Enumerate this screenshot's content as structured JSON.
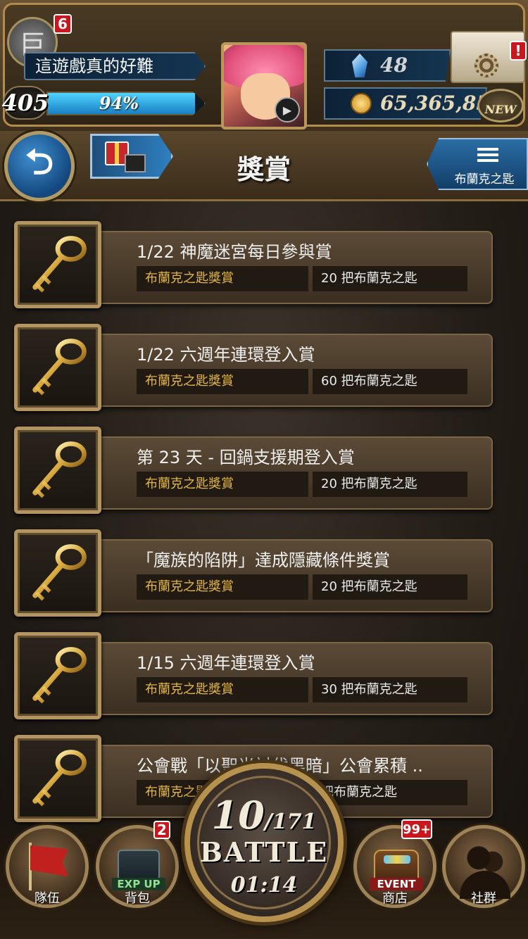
{
  "hud": {
    "profile_badge": "6",
    "player_name": "這遊戲真的好難",
    "level": "405",
    "exp_percent": "94%",
    "exp_fraction": 0.94,
    "gems": "48",
    "gold": "65,365,856",
    "settings_alert": "!",
    "new_label": "NEW"
  },
  "header": {
    "title": "獎賞",
    "key_button_label": "布蘭克之匙"
  },
  "rewards": [
    {
      "title": "1/22 神魔迷宮每日參與賞",
      "type": "布蘭克之匙獎賞",
      "amount": "20 把布蘭克之匙"
    },
    {
      "title": "1/22 六週年連環登入賞",
      "type": "布蘭克之匙獎賞",
      "amount": "60 把布蘭克之匙"
    },
    {
      "title": "第 23 天 - 回鍋支援期登入賞",
      "type": "布蘭克之匙獎賞",
      "amount": "20 把布蘭克之匙"
    },
    {
      "title": "「魔族的陷阱」達成隱藏條件獎賞",
      "type": "布蘭克之匙獎賞",
      "amount": "20 把布蘭克之匙"
    },
    {
      "title": "1/15 六週年連環登入賞",
      "type": "布蘭克之匙獎賞",
      "amount": "30 把布蘭克之匙"
    },
    {
      "title": "公會戰「以聖光討伐黑暗」公會累積 ..",
      "type": "布蘭克之匙獎賞",
      "amount": "把布蘭克之匙"
    }
  ],
  "nav": {
    "team_label": "隊伍",
    "bag_label": "背包",
    "bag_badge": "2",
    "bag_strip": "EXP UP",
    "shop_label": "商店",
    "shop_badge": "99+",
    "shop_strip": "EVENT",
    "social_label": "社群",
    "battle": {
      "stamina_current": "10",
      "stamina_separator": "/",
      "stamina_max": "171",
      "word": "BATTLE",
      "timer": "01:14"
    }
  },
  "colors": {
    "accent_gold": "#e4b540",
    "frame_gold": "#b49460",
    "blue_button": "#2b6da5",
    "badge_red": "#c8171e"
  }
}
